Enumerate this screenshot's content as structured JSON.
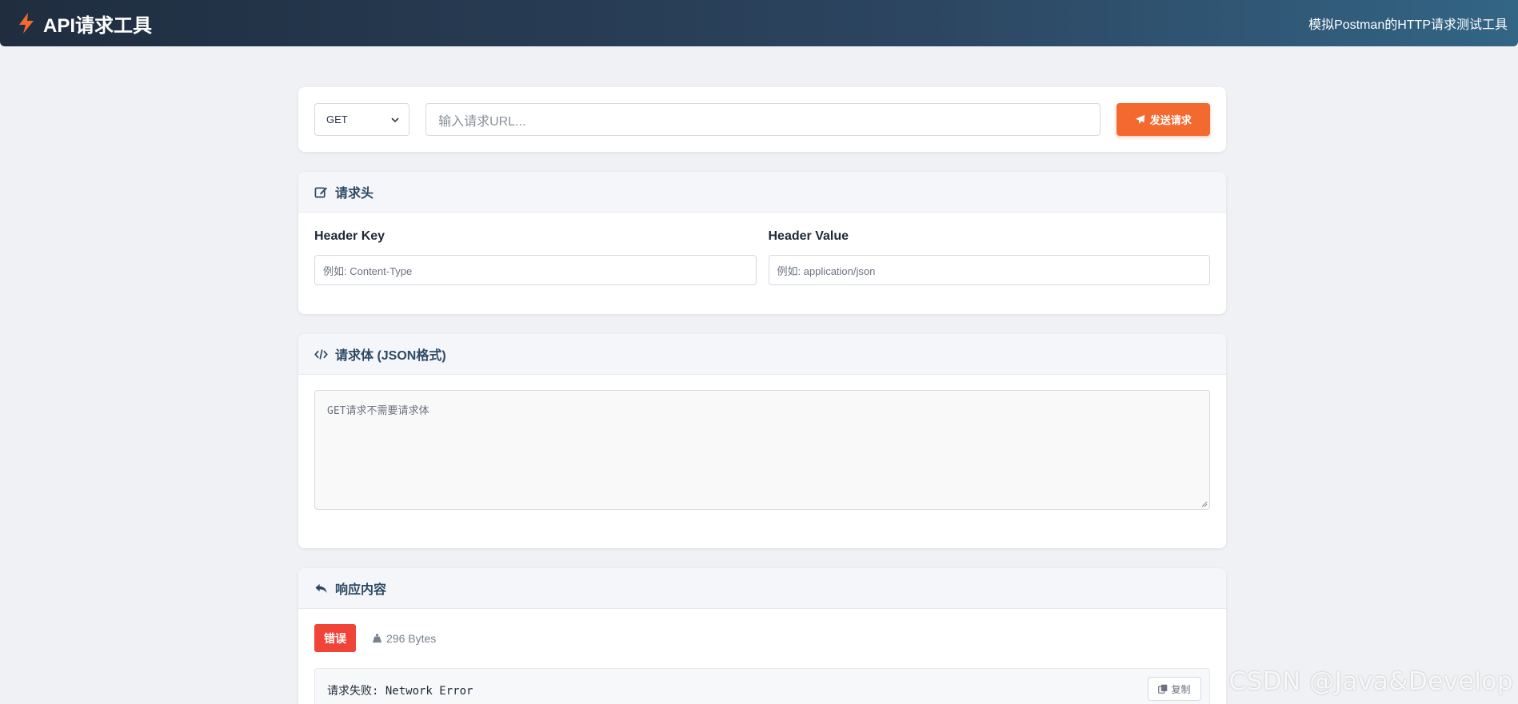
{
  "app": {
    "title": "API请求工具",
    "tagline": "模拟Postman的HTTP请求测试工具"
  },
  "request": {
    "method": "GET",
    "url_placeholder": "输入请求URL...",
    "send_label": "发送请求"
  },
  "headers_section": {
    "title": "请求头",
    "key_label": "Header Key",
    "key_placeholder": "例如: Content-Type",
    "value_label": "Header Value",
    "value_placeholder": "例如: application/json"
  },
  "body_section": {
    "title": "请求体 (JSON格式)",
    "placeholder_prefix": "GET",
    "placeholder_text": "请求不需要请求体"
  },
  "response_section": {
    "title": "响应内容",
    "status_badge": "错误",
    "size": "296 Bytes",
    "body_label": "请求失败: ",
    "body_error": "Network Error",
    "copy_label": "复制"
  },
  "watermark": "CSDN @Java&Develop",
  "colors": {
    "accent": "#f4692f",
    "error": "#f04438",
    "header_text": "#2c4a65"
  },
  "icons": {
    "brand": "bolt-icon",
    "send": "paper-plane-icon",
    "headers": "edit-icon",
    "body": "code-icon",
    "response": "reply-icon",
    "size": "weight-icon",
    "copy": "copy-icon"
  }
}
